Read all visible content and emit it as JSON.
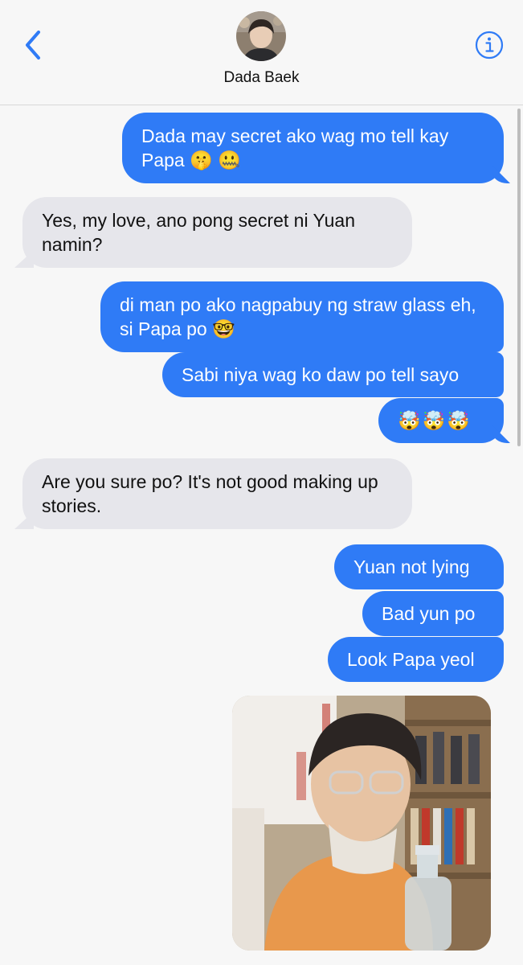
{
  "header": {
    "contact_name": "Dada Baek",
    "back_icon": "chevron-left-icon",
    "info_icon": "info-icon",
    "accent": "#2f7bf6"
  },
  "colors": {
    "outgoing": "#2f7bf6",
    "incoming": "#e6e6eb",
    "background": "#f7f7f7"
  },
  "messages": [
    {
      "from": "me",
      "text": "Dada may secret ako wag mo tell kay Papa 🤫 🤐"
    },
    {
      "from": "contact",
      "text": "Yes, my love, ano pong secret ni Yuan namin?"
    },
    {
      "from": "me",
      "text": "di man po ako nagpabuy ng straw glass eh, si Papa po 🤓"
    },
    {
      "from": "me",
      "text": "Sabi niya wag ko daw po tell sayo"
    },
    {
      "from": "me",
      "text": "🤯🤯🤯"
    },
    {
      "from": "contact",
      "text": "Are you sure po? It's not good making up stories."
    },
    {
      "from": "me",
      "text": "Yuan not lying"
    },
    {
      "from": "me",
      "text": "Bad yun po"
    },
    {
      "from": "me",
      "text": "Look Papa yeol"
    }
  ],
  "attachment": {
    "type": "image"
  }
}
